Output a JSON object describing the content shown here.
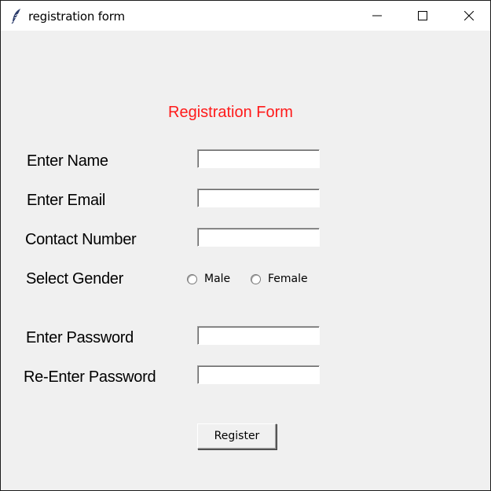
{
  "window": {
    "title": "registration form",
    "controls": {
      "minimize_icon": "minimize-icon",
      "maximize_icon": "maximize-icon",
      "close_icon": "close-icon"
    }
  },
  "form": {
    "title": "Registration Form",
    "title_color": "#ff1a1a",
    "fields": {
      "name": {
        "label": "Enter Name",
        "value": ""
      },
      "email": {
        "label": "Enter Email",
        "value": ""
      },
      "contact": {
        "label": "Contact Number",
        "value": ""
      },
      "gender": {
        "label": "Select Gender",
        "options": [
          "Male",
          "Female"
        ],
        "selected": ""
      },
      "password": {
        "label": "Enter Password",
        "value": ""
      },
      "reenter_password": {
        "label": "Re-Enter Password",
        "value": ""
      }
    },
    "submit_label": "Register"
  }
}
